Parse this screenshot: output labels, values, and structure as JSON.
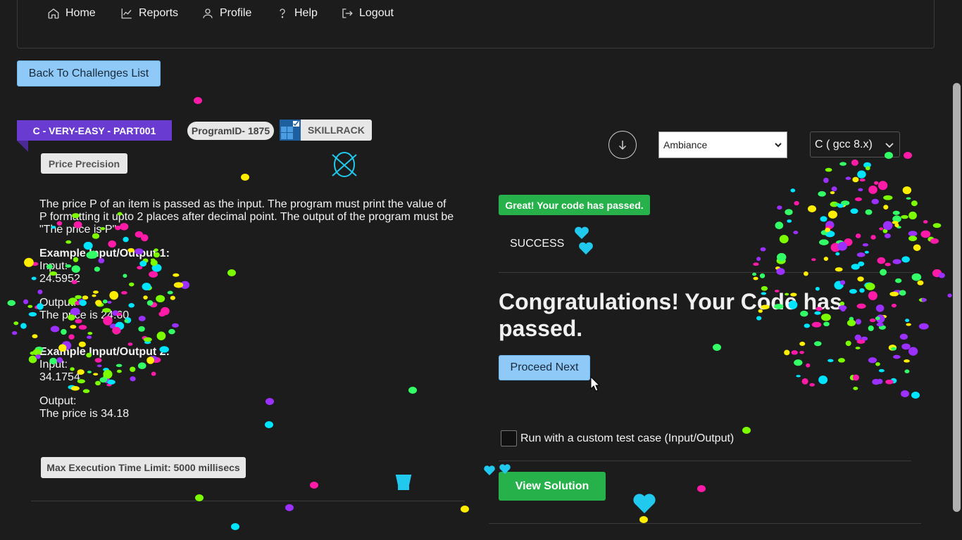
{
  "nav": {
    "items": [
      {
        "label": "Home",
        "icon": "home-icon"
      },
      {
        "label": "Reports",
        "icon": "chart-icon"
      },
      {
        "label": "Profile",
        "icon": "user-icon"
      },
      {
        "label": "Help",
        "icon": "question-icon"
      },
      {
        "label": "Logout",
        "icon": "logout-icon"
      }
    ]
  },
  "back_button": "Back To Challenges List",
  "challenge": {
    "level": "C - VERY-EASY - PART001",
    "program_id": "ProgramID- 1875",
    "brand": "SKILLRACK",
    "title": "Price Precision",
    "description": "The price P of an item is passed as the input. The program must print the value of P formatting it upto 2 places after decimal point. The output of the program must be \"The price is P\"",
    "example1_heading": "Example Input/Output 1:",
    "example1_input_label": "Input:",
    "example1_input": "24.5952",
    "example1_output_label": "Output:",
    "example1_output": "The price is 24.60",
    "example2_heading": "Example Input/Output 2:",
    "example2_input_label": "Input:",
    "example2_input": "34.1754",
    "example2_output_label": "Output:",
    "example2_output": "The price is 34.18",
    "max_time": "Max Execution Time Limit: 5000 millisecs"
  },
  "editor": {
    "theme": "Ambiance",
    "language": "C ( gcc 8.x)"
  },
  "result": {
    "badge": "Great! Your code has passed.",
    "status": "SUCCESS",
    "congrats": "Congratulations! Your Code has passed.",
    "proceed": "Proceed Next",
    "custom_test": "Run with a custom test case (Input/Output)",
    "view_solution": "View Solution"
  },
  "colors": {
    "background": "#1c1c1c",
    "ribbon": "#6a3bd1",
    "success_green": "#27b14a",
    "light_blue_button": "#8ec9f7"
  }
}
